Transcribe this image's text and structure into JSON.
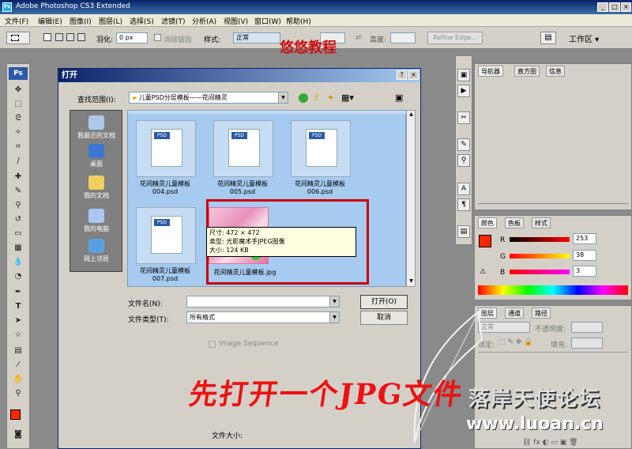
{
  "titlebar": {
    "title": "Adobe Photoshop CS3 Extended",
    "app_icon": "Ps"
  },
  "menu": [
    "文件(F)",
    "编辑(E)",
    "图像(I)",
    "图层(L)",
    "选择(S)",
    "滤镜(T)",
    "分析(A)",
    "视图(V)",
    "窗口(W)",
    "帮助(H)"
  ],
  "options": {
    "feather_label": "羽化:",
    "feather_value": "0 px",
    "antialias_label": "消除锯齿",
    "style_label": "样式:",
    "style_value": "正常",
    "width_label": "宽度:",
    "height_label": "高度:",
    "refine_edge": "Refine Edge...",
    "workspace": "工作区 ▾"
  },
  "watermark_title": "悠悠教程",
  "toolbox": {
    "badge": "Ps"
  },
  "panels": {
    "navigator_tabs": [
      "导航器",
      "直方图",
      "信息"
    ],
    "color_tabs": [
      "颜色",
      "色板",
      "样式"
    ],
    "color_values": {
      "R": "253",
      "G": "38",
      "B": "3"
    },
    "layers_tabs": [
      "图层",
      "通道",
      "路径"
    ],
    "layers_mode": "正常",
    "opacity_label": "不透明度:",
    "lock_label": "锁定:",
    "fill_label": "填充:"
  },
  "dialog": {
    "title": "打开",
    "help": "?",
    "close": "×",
    "lookin_label": "查找范围(I):",
    "lookin_value": "儿童PSD分层模板——花间精灵",
    "places": [
      {
        "label": "我最近的文档",
        "icon": "recent-docs-icon"
      },
      {
        "label": "桌面",
        "icon": "desktop-icon"
      },
      {
        "label": "我的文档",
        "icon": "my-documents-icon"
      },
      {
        "label": "我的电脑",
        "icon": "my-computer-icon"
      },
      {
        "label": "网上邻居",
        "icon": "network-icon"
      }
    ],
    "files": [
      {
        "name": "花间精灵儿童模板004.psd",
        "badge": "PSD"
      },
      {
        "name": "花间精灵儿童模板005.psd",
        "badge": "PSD"
      },
      {
        "name": "花间精灵儿童模板006.psd",
        "badge": "PSD"
      },
      {
        "name": "花间精灵儿童模板007.psd",
        "badge": "PSD"
      },
      {
        "name": "花间精灵儿童模板.jpg",
        "badge": ""
      }
    ],
    "tooltip": {
      "size": "尺寸: 472 × 472",
      "type": "类型: 光影魔术手JPEG图像",
      "filesize": "大小: 124 KB"
    },
    "filename_label": "文件名(N):",
    "filetype_label": "文件类型(T):",
    "filetype_value": "所有格式",
    "open_button": "打开(O)",
    "cancel_button": "取消",
    "image_sequence": "Image Sequence",
    "filesize_label": "文件大小:"
  },
  "overlay_text": "先打开一个JPG文件",
  "site": {
    "name": "落岸天使论坛",
    "url": "www.luoan.cn"
  },
  "colors": {
    "accent_red": "#e11111",
    "titlebar": "#0a246a",
    "filelist_bg": "#a6caf0",
    "fg_swatch": "#fd2603"
  }
}
